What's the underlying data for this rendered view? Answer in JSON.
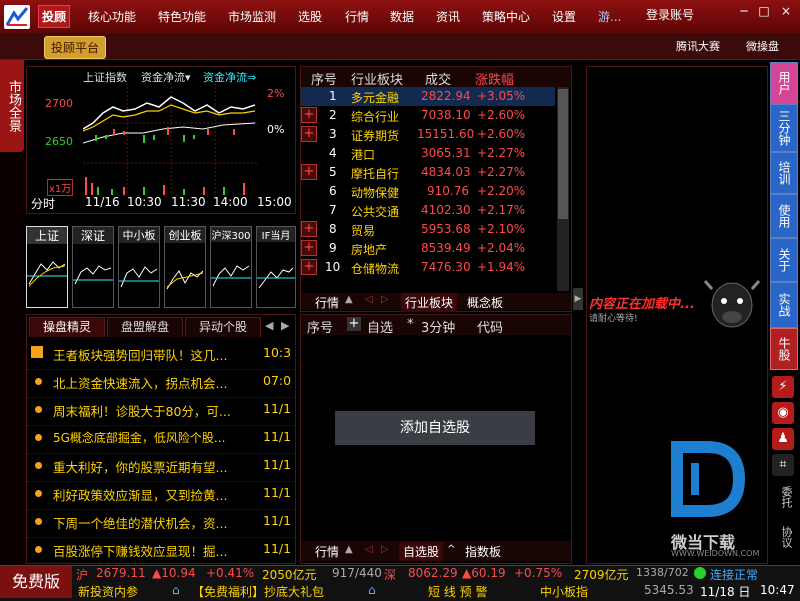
{
  "menu": {
    "items": [
      "投顾",
      "核心功能",
      "特色功能",
      "市场监测",
      "选股",
      "行情",
      "数据",
      "资讯",
      "策略中心",
      "设置",
      "游..."
    ],
    "login": "登录账号",
    "min": "─",
    "max": "□",
    "close": "×"
  },
  "toolbar": {
    "platform": "投顾平台",
    "tengxun": "腾讯大赛",
    "weicaopan": "微操盘"
  },
  "left_tab": "市场全景",
  "index_panel": {
    "name": "上证指数",
    "flow1": "资金净流▾",
    "flow2": "资金净流⇒",
    "p1": "2700",
    "p2": "2650",
    "pct1": "2%",
    "pct2": "0%",
    "vol_unit": "x1万",
    "period": "分时",
    "times": [
      "11/16",
      "10:30",
      "11:30",
      "14:00",
      "15:00"
    ]
  },
  "thumbs": [
    "上证",
    "深证",
    "中小板",
    "创业板",
    "沪深300",
    "IF当月"
  ],
  "news": {
    "tabs": [
      "操盘精灵",
      "盘盟解盘",
      "异动个股"
    ],
    "items": [
      {
        "title": "王者板块强势回归带队！这几...",
        "time": "10:3"
      },
      {
        "title": "北上资金快速流入，拐点机会...",
        "time": "07:0"
      },
      {
        "title": "周末福利！诊股大于80分，可...",
        "time": "11/1"
      },
      {
        "title": "5G概念底部掘金，低风险个股...",
        "time": "11/1"
      },
      {
        "title": "重大利好，你的股票近期有望...",
        "time": "11/1"
      },
      {
        "title": "利好政策效应渐显，又到捡黄...",
        "time": "11/1"
      },
      {
        "title": "下周一个绝佳的潜伏机会，资...",
        "time": "11/1"
      },
      {
        "title": "百股涨停下赚钱效应显现！掘...",
        "time": "11/1"
      }
    ]
  },
  "sector": {
    "headers": [
      "序号",
      "行业板块",
      "成交",
      "涨跌幅"
    ],
    "rows": [
      {
        "no": "1",
        "name": "多元金融",
        "vol": "2822.94",
        "chg": "+3.05%"
      },
      {
        "no": "2",
        "name": "综合行业",
        "vol": "7038.10",
        "chg": "+2.60%"
      },
      {
        "no": "3",
        "name": "证券期货",
        "vol": "15151.60",
        "chg": "+2.60%"
      },
      {
        "no": "4",
        "name": "港口",
        "vol": "3065.31",
        "chg": "+2.27%"
      },
      {
        "no": "5",
        "name": "摩托自行",
        "vol": "4834.03",
        "chg": "+2.27%"
      },
      {
        "no": "6",
        "name": "动物保健",
        "vol": "910.76",
        "chg": "+2.20%"
      },
      {
        "no": "7",
        "name": "公共交通",
        "vol": "4102.30",
        "chg": "+2.17%"
      },
      {
        "no": "8",
        "name": "贸易",
        "vol": "5953.68",
        "chg": "+2.10%"
      },
      {
        "no": "9",
        "name": "房地产",
        "vol": "8539.49",
        "chg": "+2.04%"
      },
      {
        "no": "10",
        "name": "仓储物流",
        "vol": "7476.30",
        "chg": "+1.94%"
      }
    ],
    "tabs": [
      "行情",
      "行业板块",
      "概念板"
    ]
  },
  "selfselect": {
    "headers": [
      "序号",
      "自选",
      "3分钟",
      "代码"
    ],
    "add_btn": "添加自选股",
    "tabs": [
      "行情",
      "自选股",
      "指数板"
    ]
  },
  "ad": {
    "loading": "内容正在加载中...",
    "wait": "请耐心等待!",
    "watermark": "微当下载",
    "watermark_url": "WWW.WEIDOWN.COM"
  },
  "right_tabs": [
    "用户",
    "三分钟",
    "培训",
    "使用",
    "关于",
    "实战",
    "牛股"
  ],
  "right_bottom": [
    "委托",
    "协议"
  ],
  "status": {
    "free": "免费版",
    "sh": "沪",
    "sh_val": "2679.11",
    "sh_chg": "▲10.94",
    "sh_pct": "+0.41%",
    "sh_amt": "2050亿元",
    "sh_updn": "917/440",
    "sz": "深",
    "sz_val": "8062.29",
    "sz_chg": "▲60.19",
    "sz_pct": "+0.75%",
    "sz_amt": "2709亿元",
    "sz_updn": "1338/702",
    "conn": "连接正常",
    "ticker1": "新投资内参",
    "ticker2": "【免费福利】抄底大礼包",
    "alert": "短 线 预 警",
    "board": "中小板指",
    "board_val": "5345.53",
    "date": "11/18 日",
    "clock": "10:47"
  }
}
